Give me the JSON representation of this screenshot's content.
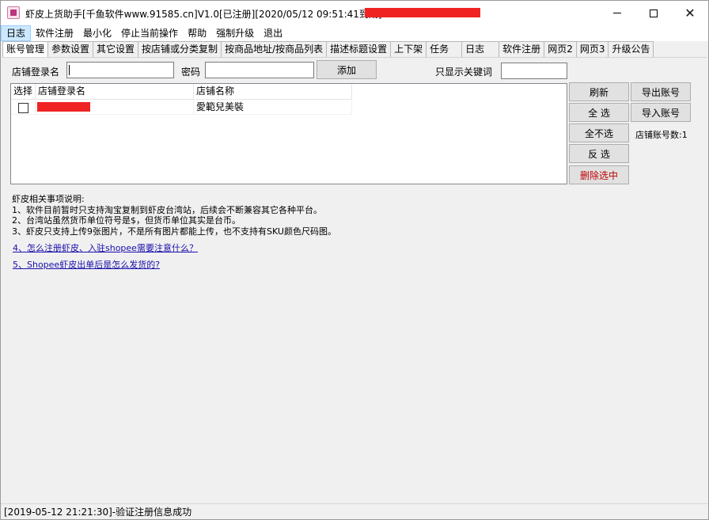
{
  "window": {
    "title": "虾皮上货助手[千鱼软件www.91585.cn]V1.0[已注册][2020/05/12 09:51:41到期]"
  },
  "menu": [
    "日志",
    "软件注册",
    "最小化",
    "停止当前操作",
    "帮助",
    "强制升级",
    "退出"
  ],
  "tabs": [
    "账号管理",
    "参数设置",
    "其它设置",
    "按店铺或分类复制",
    "按商品地址/按商品列表",
    "描述标题设置",
    "上下架",
    "任务",
    "日志",
    "软件注册",
    "网页2",
    "网页3",
    "升级公告"
  ],
  "form": {
    "store_login_label": "店铺登录名",
    "store_login_value": "",
    "password_label": "密码",
    "password_value": "",
    "add_button": "添加",
    "keyword_label": "只显示关键词",
    "keyword_value": ""
  },
  "list": {
    "columns": [
      "选择",
      "店铺登录名",
      "店铺名称"
    ],
    "rows": [
      {
        "checked": false,
        "login": "",
        "name": "愛範兒美裝"
      }
    ]
  },
  "buttons": {
    "refresh": "刷新",
    "export": "导出账号",
    "select_all": "全 选",
    "import": "导入账号",
    "deselect_all": "全不选",
    "invert": "反 选",
    "delete_selected": "删除选中"
  },
  "account_count": "店铺账号数:1",
  "notes": {
    "heading": "虾皮相关事项说明:",
    "lines": [
      "1、软件目前暂时只支持淘宝复制到虾皮台湾站，后续会不断兼容其它各种平台。",
      "2、台湾站虽然货币单位符号是$，但货币单位其实是台币。",
      "3、虾皮只支持上传9张图片，不是所有图片都能上传，也不支持有SKU颜色尺码图。"
    ],
    "link1": "4、怎么注册虾皮、入驻shopee需要注意什么？",
    "link2": "5、Shopee虾皮出单后是怎么发货的?"
  },
  "status": "[2019-05-12 21:21:30]-验证注册信息成功"
}
